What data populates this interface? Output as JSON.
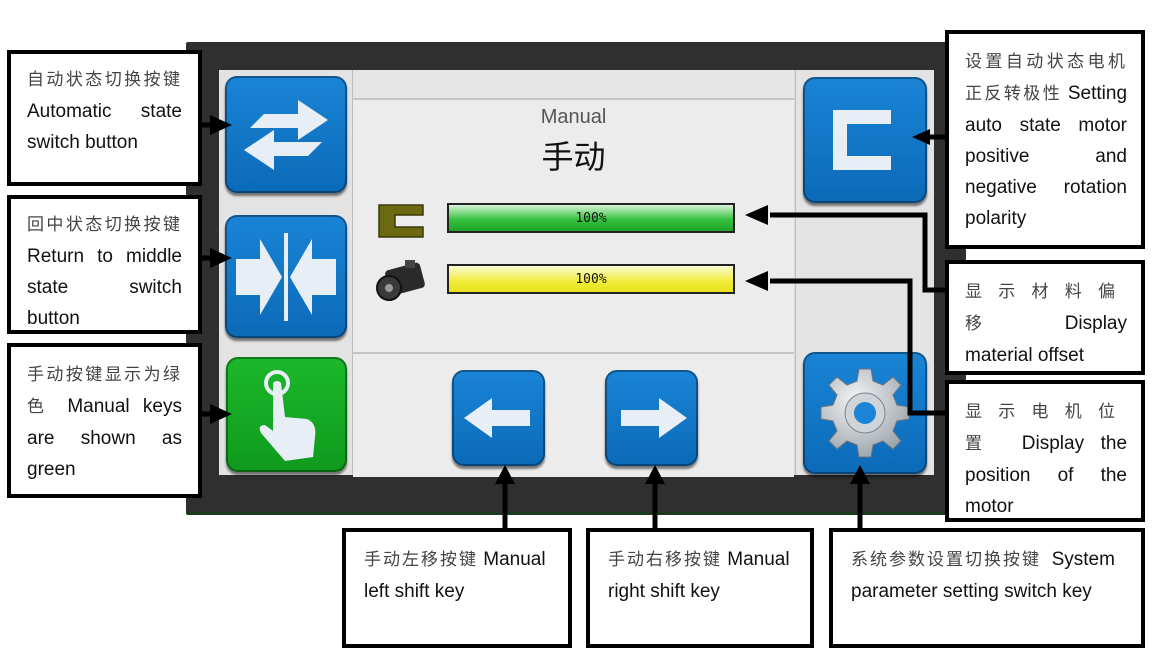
{
  "screen": {
    "title_en": "Manual",
    "title_cn": "手动",
    "bars": [
      {
        "name": "material-offset",
        "label": "100%",
        "value_percent": 100,
        "color": "#37c23f"
      },
      {
        "name": "motor-position",
        "label": "100%",
        "value_percent": 100,
        "color": "#f0ec3a"
      }
    ],
    "buttons": {
      "auto_state": {
        "icon": "swap-arrows-icon",
        "color": "#1a84d6"
      },
      "return_middle": {
        "icon": "converge-arrows-icon",
        "color": "#1a84d6"
      },
      "manual": {
        "icon": "hand-pointer-icon",
        "color": "#1cb82a"
      },
      "polarity": {
        "icon": "bracket-c-icon",
        "color": "#1a84d6"
      },
      "left_shift": {
        "icon": "arrow-left-icon",
        "color": "#1a84d6"
      },
      "right_shift": {
        "icon": "arrow-right-icon",
        "color": "#1a84d6"
      },
      "settings": {
        "icon": "gear-icon",
        "color": "#1a84d6"
      }
    }
  },
  "callouts": {
    "auto_state": {
      "cn": "自动状态切换按键",
      "en": "Automatic state switch button"
    },
    "return_middle": {
      "cn": "回中状态切换按键",
      "en": "Return to middle state switch button"
    },
    "manual_green": {
      "cn": "手动按键显示为绿色",
      "en": "Manual keys are shown as green"
    },
    "polarity": {
      "cn": "设置自动状态电机正反转极性",
      "en": "Setting auto state motor positive and negative rotation polarity"
    },
    "material_offset": {
      "cn": "显示材料偏移",
      "en": "Display material offset"
    },
    "motor_position": {
      "cn": "显示电机位置",
      "en": "Display the position of the motor"
    },
    "left_shift": {
      "cn": "手动左移按键",
      "en": "Manual left shift key"
    },
    "right_shift": {
      "cn": "手动右移按键",
      "en": "Manual right shift key"
    },
    "system_params": {
      "cn": "系统参数设置切换按键",
      "en": "System parameter setting switch key"
    }
  }
}
